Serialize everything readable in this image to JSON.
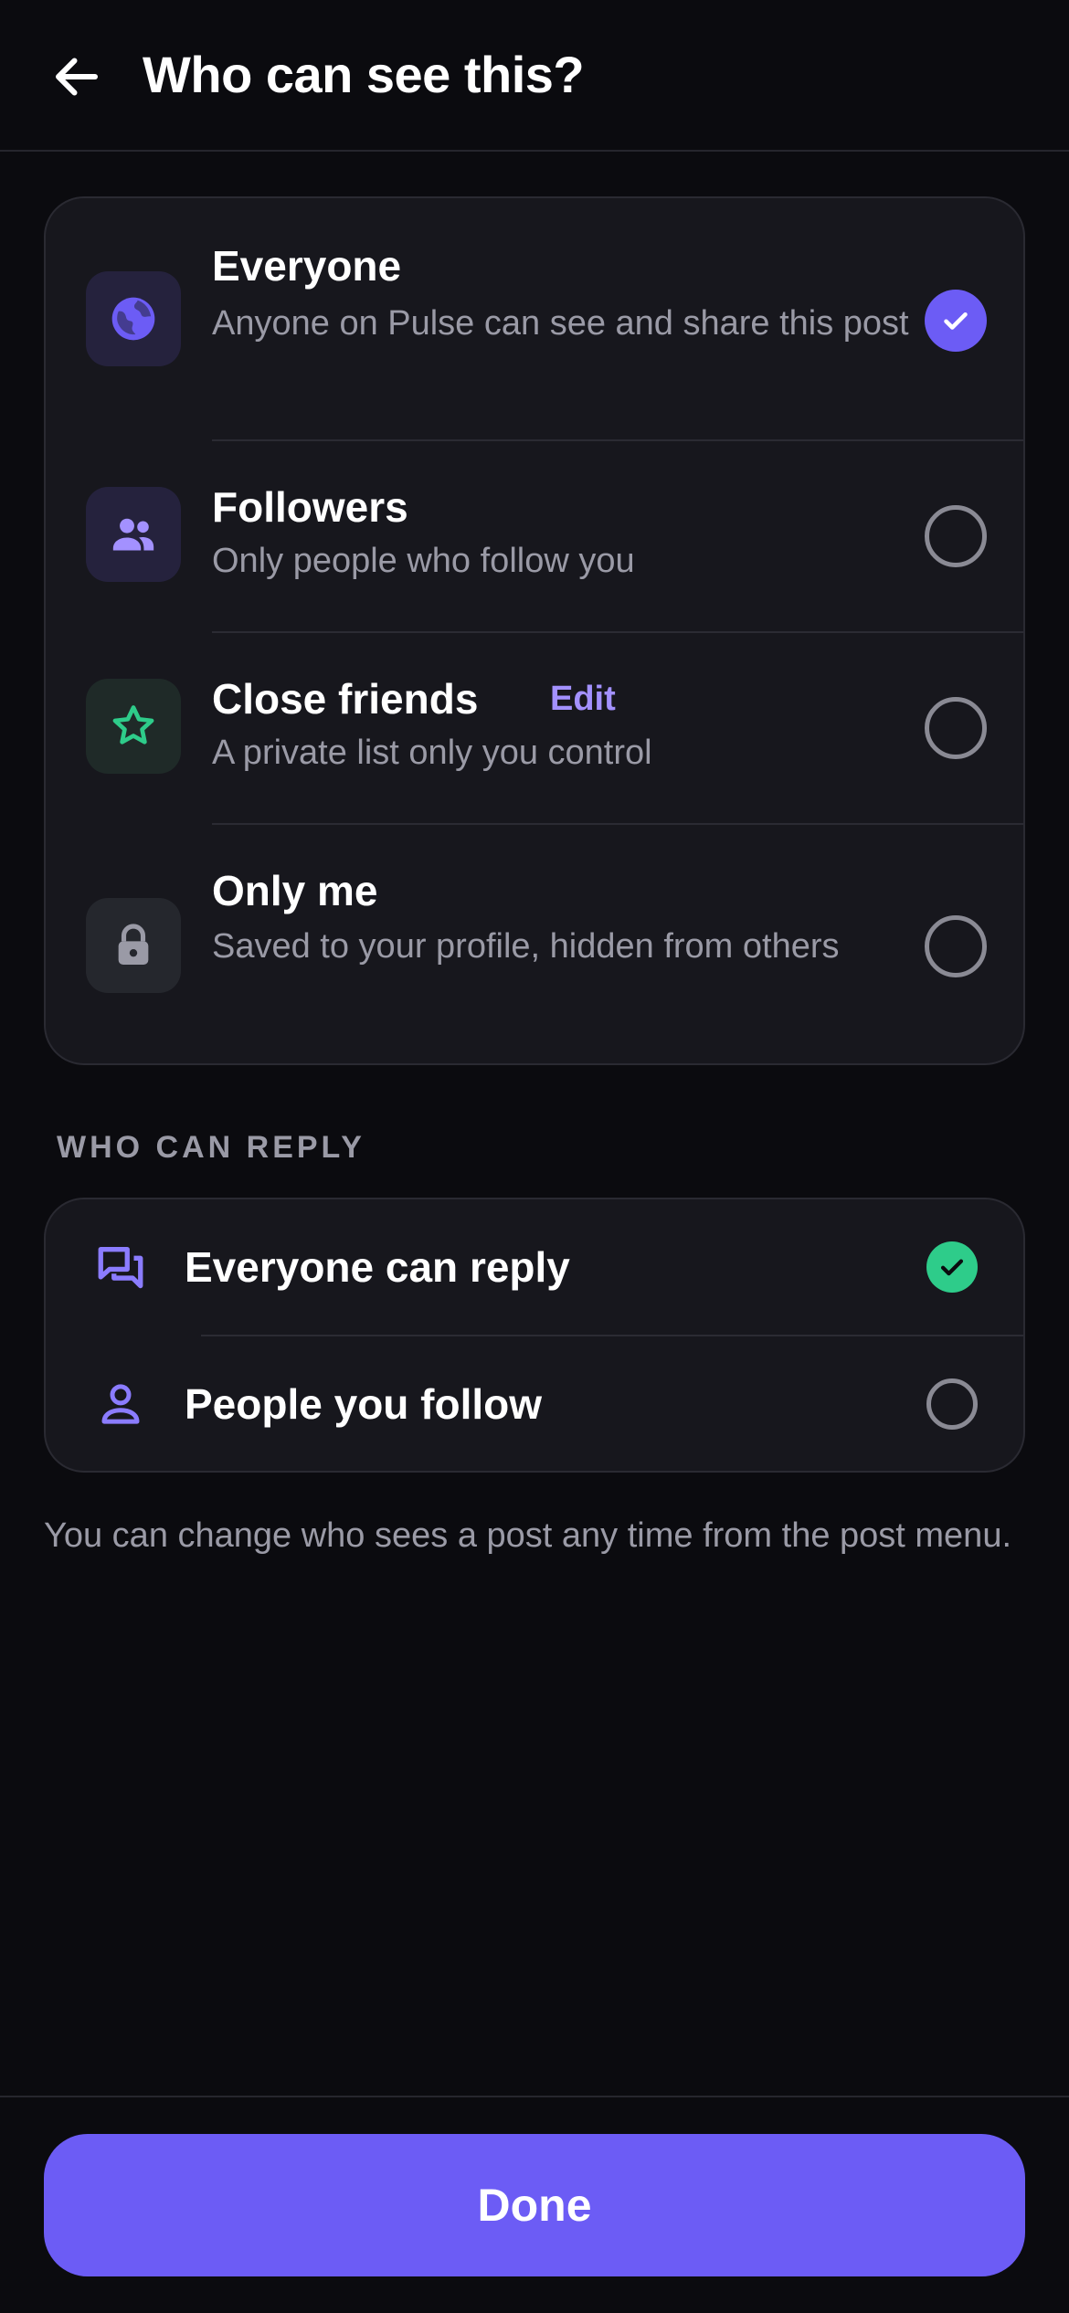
{
  "header": {
    "title": "Who can see this?",
    "back_icon": "arrow-left-icon"
  },
  "visibility": {
    "selected": "everyone",
    "options": [
      {
        "id": "everyone",
        "title": "Everyone",
        "description": "Anyone on Pulse can see and share this post",
        "icon": "globe-icon",
        "checked": true
      },
      {
        "id": "followers",
        "title": "Followers",
        "description": "Only people who follow you",
        "icon": "people-icon",
        "checked": false
      },
      {
        "id": "close-friends",
        "title": "Close friends",
        "edit_label": "Edit",
        "description": "A private list only you control",
        "icon": "star-icon",
        "checked": false
      },
      {
        "id": "only-me",
        "title": "Only me",
        "description": "Saved to your profile, hidden from others",
        "icon": "lock-icon",
        "checked": false
      }
    ]
  },
  "reply": {
    "section_label": "WHO CAN REPLY",
    "options": [
      {
        "label": "Everyone can reply",
        "icon": "chat-bubbles-icon",
        "checked": true
      },
      {
        "label": "People you follow",
        "icon": "person-icon",
        "checked": false
      }
    ]
  },
  "footnote": "You can change who sees a post any time from the post menu.",
  "done_label": "Done",
  "colors": {
    "accent": "#6c5cf5",
    "accent_light": "#a391ff",
    "success": "#2ecc8a",
    "background": "#0b0b0f",
    "card": "#17171d"
  }
}
